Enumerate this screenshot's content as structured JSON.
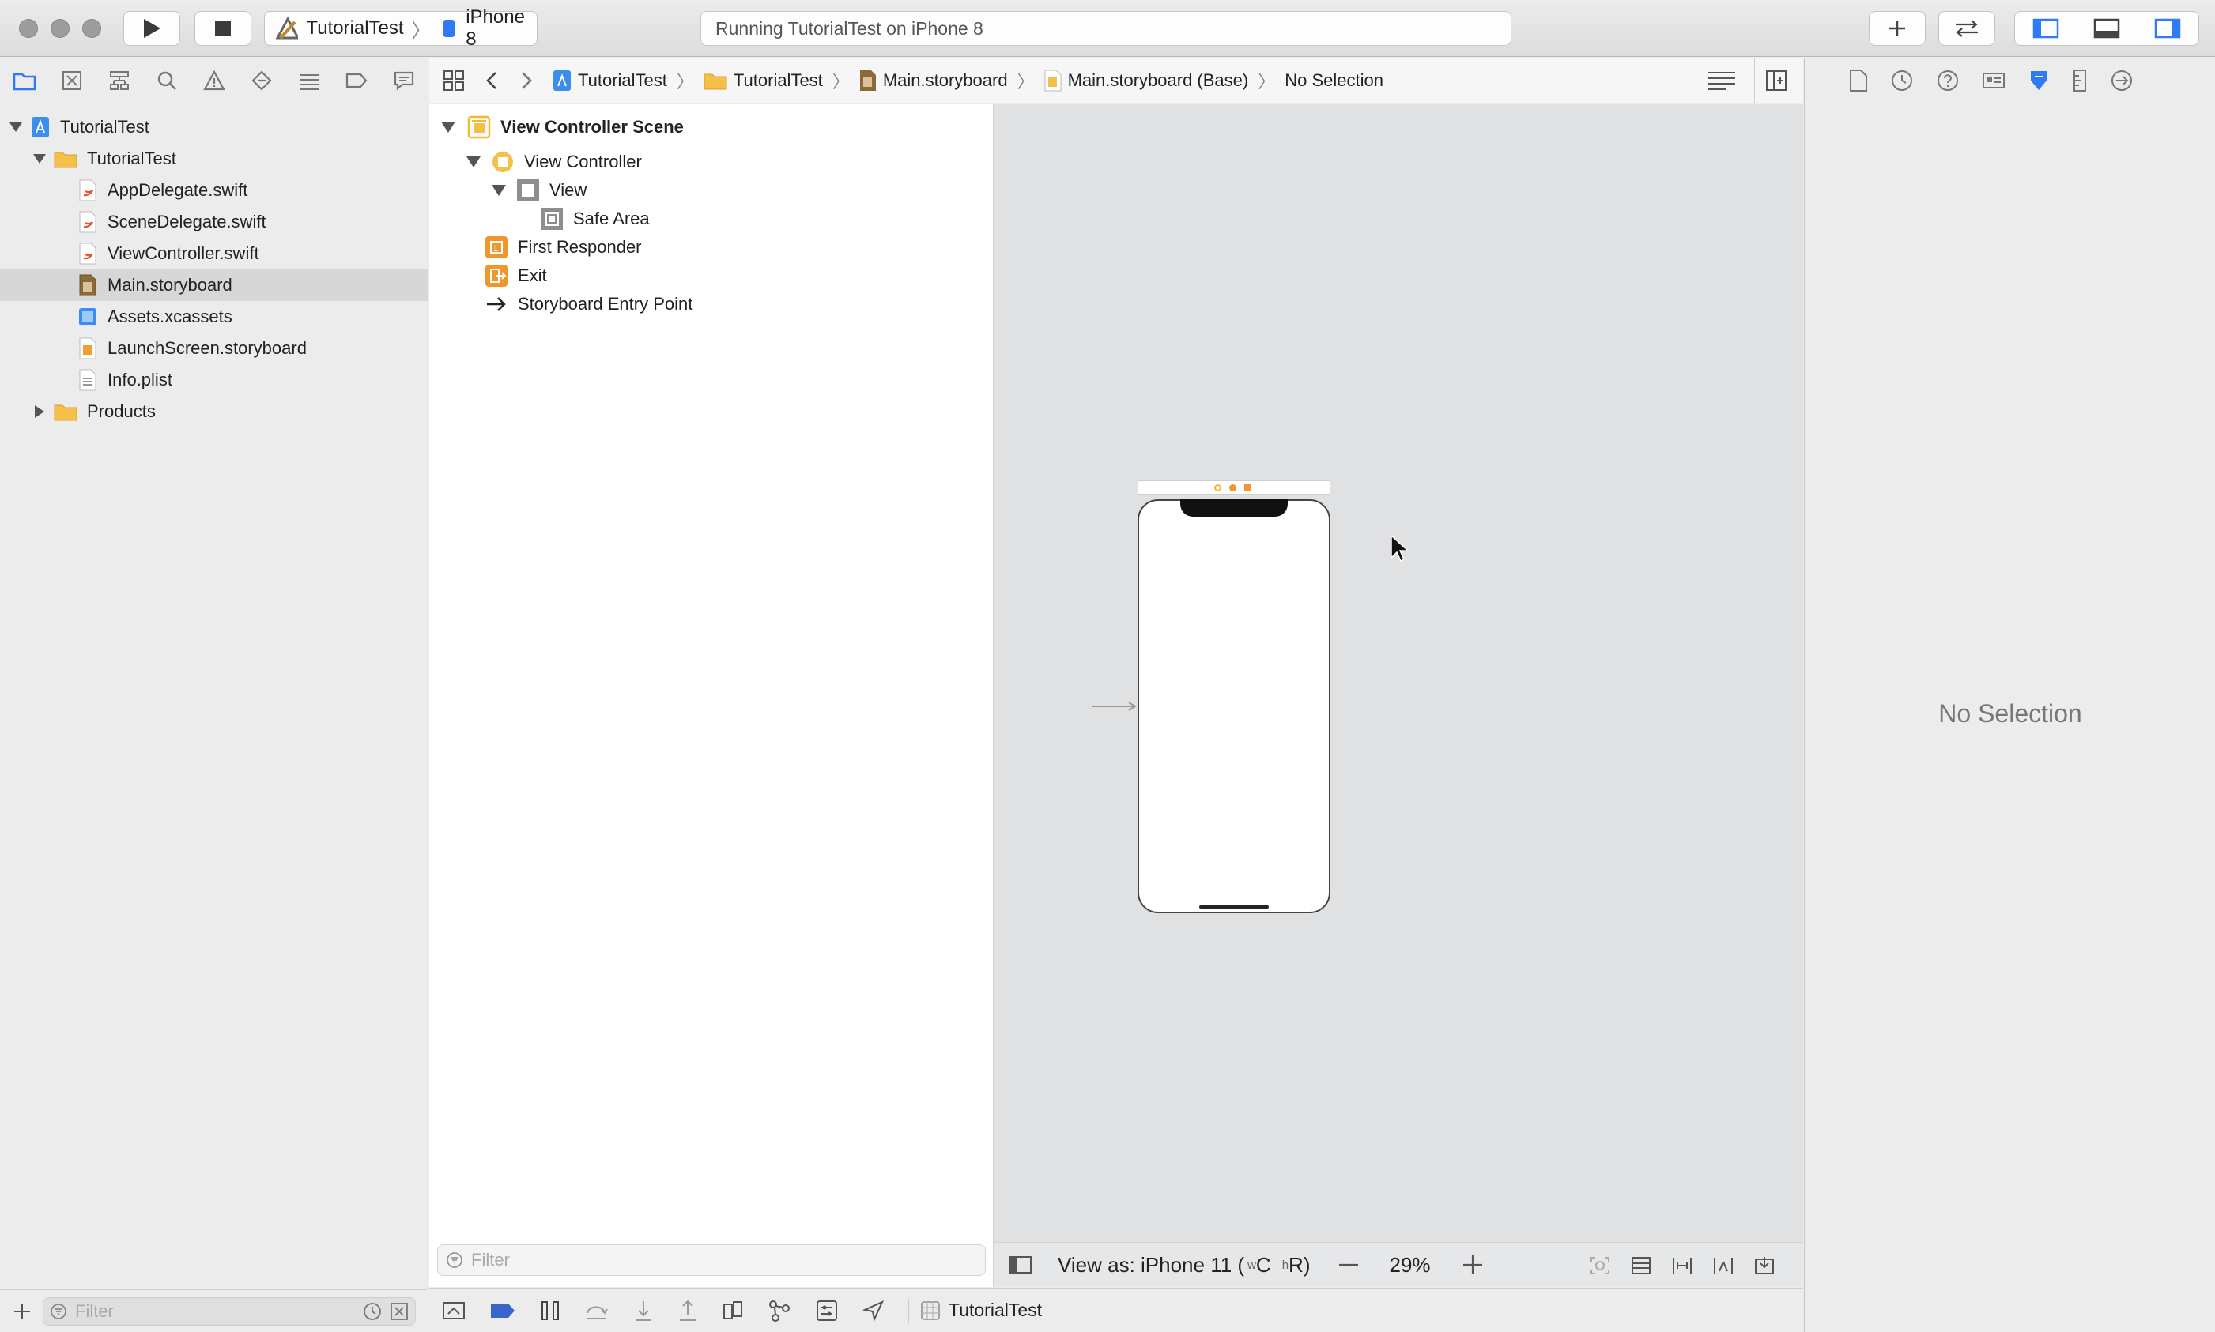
{
  "toolbar": {
    "scheme_project": "TutorialTest",
    "scheme_device": "iPhone 8",
    "activity_text": "Running TutorialTest on iPhone 8"
  },
  "navigator": {
    "items": [
      {
        "label": "TutorialTest",
        "icon": "xcode-project-icon"
      },
      {
        "label": "TutorialTest",
        "icon": "folder-icon"
      },
      {
        "label": "AppDelegate.swift",
        "icon": "swift-file-icon"
      },
      {
        "label": "SceneDelegate.swift",
        "icon": "swift-file-icon"
      },
      {
        "label": "ViewController.swift",
        "icon": "swift-file-icon"
      },
      {
        "label": "Main.storyboard",
        "icon": "storyboard-file-icon",
        "selected": true
      },
      {
        "label": "Assets.xcassets",
        "icon": "asset-catalog-icon"
      },
      {
        "label": "LaunchScreen.storyboard",
        "icon": "storyboard-file-icon"
      },
      {
        "label": "Info.plist",
        "icon": "plist-file-icon"
      },
      {
        "label": "Products",
        "icon": "folder-icon"
      }
    ],
    "filter_placeholder": "Filter"
  },
  "jumpbar": {
    "crumbs": [
      "TutorialTest",
      "TutorialTest",
      "Main.storyboard",
      "Main.storyboard (Base)",
      "No Selection"
    ]
  },
  "outline": {
    "scene_title": "View Controller Scene",
    "items": [
      "View Controller",
      "View",
      "Safe Area",
      "First Responder",
      "Exit",
      "Storyboard Entry Point"
    ],
    "filter_placeholder": "Filter"
  },
  "canvas": {
    "view_as_label": "View as: iPhone 11 (",
    "size_class_w": "w",
    "size_class_w_value": "C",
    "size_class_h": "h",
    "size_class_h_value": "R)",
    "zoom": "29%"
  },
  "debug": {
    "target_label": "TutorialTest"
  },
  "inspector": {
    "empty_text": "No Selection"
  },
  "colors": {
    "accent_blue": "#2f7bf6",
    "folder_yellow": "#f5c04a",
    "swift_orange": "#e8542f",
    "storyboard_orange": "#f0a030"
  }
}
